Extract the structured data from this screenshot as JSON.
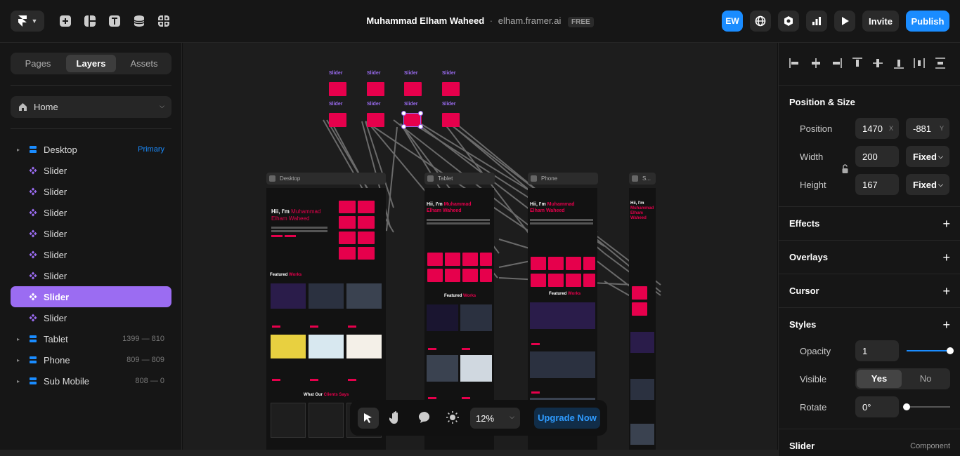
{
  "topbar": {
    "project_owner": "Muhammad Elham Waheed",
    "separator": "·",
    "domain": "elham.framer.ai",
    "plan_badge": "FREE",
    "avatar_initials": "EW",
    "invite_label": "Invite",
    "publish_label": "Publish",
    "tool_icons": [
      "insert-icon",
      "layout-icon",
      "text-icon",
      "cms-icon",
      "components-icon"
    ],
    "right_icons": [
      "globe-icon",
      "settings-icon",
      "analytics-icon",
      "preview-play-icon"
    ]
  },
  "left_panel": {
    "tabs": [
      {
        "label": "Pages",
        "active": false
      },
      {
        "label": "Layers",
        "active": true
      },
      {
        "label": "Assets",
        "active": false
      }
    ],
    "page_select": "Home",
    "layers": [
      {
        "label": "Desktop",
        "type": "breakpoint",
        "meta": "Primary",
        "expandable": true,
        "selected": false
      },
      {
        "label": "Slider",
        "type": "component",
        "meta": "",
        "expandable": false,
        "selected": false
      },
      {
        "label": "Slider",
        "type": "component",
        "meta": "",
        "expandable": false,
        "selected": false
      },
      {
        "label": "Slider",
        "type": "component",
        "meta": "",
        "expandable": false,
        "selected": false
      },
      {
        "label": "Slider",
        "type": "component",
        "meta": "",
        "expandable": false,
        "selected": false
      },
      {
        "label": "Slider",
        "type": "component",
        "meta": "",
        "expandable": false,
        "selected": false
      },
      {
        "label": "Slider",
        "type": "component",
        "meta": "",
        "expandable": false,
        "selected": false
      },
      {
        "label": "Slider",
        "type": "component",
        "meta": "",
        "expandable": false,
        "selected": true
      },
      {
        "label": "Slider",
        "type": "component",
        "meta": "",
        "expandable": false,
        "selected": false
      },
      {
        "label": "Tablet",
        "type": "breakpoint",
        "meta": "1399 — 810",
        "expandable": true,
        "selected": false
      },
      {
        "label": "Phone",
        "type": "breakpoint",
        "meta": "809 — 809",
        "expandable": true,
        "selected": false
      },
      {
        "label": "Sub Mobile",
        "type": "breakpoint",
        "meta": "808 — 0",
        "expandable": true,
        "selected": false
      }
    ]
  },
  "canvas": {
    "slider_label": "Slider",
    "frames": [
      "Desktop",
      "Tablet",
      "Phone",
      "S..."
    ],
    "hero_line1": "Hii, I'm",
    "hero_name": "Muhammad Elham Waheed",
    "featured_label": "Featured",
    "featured_accent": "Works",
    "clients_label": "What Our",
    "clients_accent": "Clients Says"
  },
  "dock": {
    "tools": [
      "pointer-icon",
      "hand-icon",
      "comment-icon",
      "theme-icon"
    ],
    "zoom": "12%",
    "upgrade_label": "Upgrade Now"
  },
  "right_panel": {
    "align_icons": [
      "align-left-icon",
      "align-center-h-icon",
      "align-right-icon",
      "align-top-icon",
      "align-middle-v-icon",
      "align-bottom-icon",
      "distribute-h-icon",
      "distribute-v-icon"
    ],
    "position_size": {
      "title": "Position & Size",
      "position_label": "Position",
      "x_value": "1470",
      "x_unit": "X",
      "y_value": "-881",
      "y_unit": "Y",
      "width_label": "Width",
      "width_value": "200",
      "width_mode": "Fixed",
      "height_label": "Height",
      "height_value": "167",
      "height_mode": "Fixed"
    },
    "sections": [
      "Effects",
      "Overlays",
      "Cursor",
      "Styles"
    ],
    "styles": {
      "opacity_label": "Opacity",
      "opacity_value": "1",
      "opacity_level": 1.0,
      "visible_label": "Visible",
      "visible_yes": "Yes",
      "visible_no": "No",
      "rotate_label": "Rotate",
      "rotate_value": "0°",
      "rotate_level": 0
    },
    "component_title": "Slider",
    "component_tag": "Component"
  },
  "colors": {
    "accent_blue": "#1a8cff",
    "selection_purple": "#9b6cf2",
    "brand_pink": "#e6004c"
  }
}
